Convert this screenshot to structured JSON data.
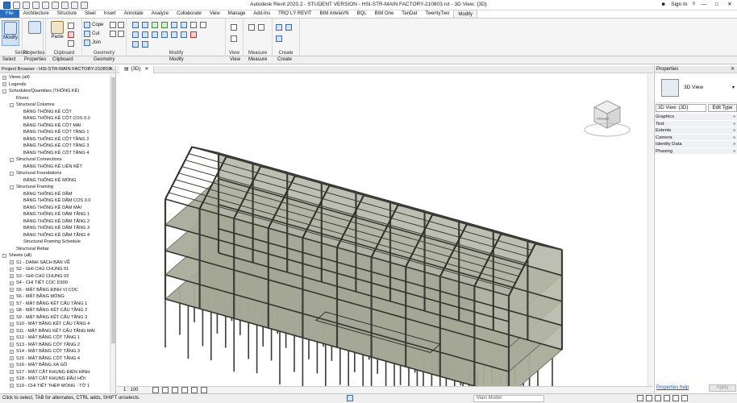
{
  "app": {
    "title": "Autodesk Revit 2020.2 - STUDENT VERSION - HSI-STR-MAIN FACTORY-210803.rvt - 3D View: {3D}",
    "sign_in": "Sign In",
    "help": "?"
  },
  "ribbon_tabs": [
    {
      "label": "File",
      "active": false
    },
    {
      "label": "Architecture",
      "active": false
    },
    {
      "label": "Structure",
      "active": false
    },
    {
      "label": "Steel",
      "active": false
    },
    {
      "label": "Insert",
      "active": false
    },
    {
      "label": "Annotate",
      "active": false
    },
    {
      "label": "Analyze",
      "active": false
    },
    {
      "label": "Collaborate",
      "active": false
    },
    {
      "label": "View",
      "active": false
    },
    {
      "label": "Manage",
      "active": false
    },
    {
      "label": "Add-Ins",
      "active": false
    },
    {
      "label": "TRỢ LÝ REVIT",
      "active": false
    },
    {
      "label": "BIM ArtelaVN",
      "active": false
    },
    {
      "label": "BQL",
      "active": false
    },
    {
      "label": "BIM One",
      "active": false
    },
    {
      "label": "TanDat",
      "active": false
    },
    {
      "label": "TwentyTwo",
      "active": false
    },
    {
      "label": "Modify",
      "active": true
    }
  ],
  "ribbon": {
    "modify_label": "Modify",
    "paste_label": "Paste",
    "cope_label": "Cope",
    "cut_label": "Cut",
    "join_label": "Join",
    "groups": [
      "Select",
      "Properties",
      "Clipboard",
      "Geometry",
      "Modify",
      "View",
      "Measure",
      "Create"
    ]
  },
  "project_browser": {
    "title": "Project Browser - HSI-STR-MAIN FACTORY-210803...",
    "items": [
      {
        "label": "Views (all)",
        "level": 0,
        "exp": "+"
      },
      {
        "label": "Legends",
        "level": 0,
        "exp": "+"
      },
      {
        "label": "Schedules/Quantities (THỐNG KÊ)",
        "level": 0,
        "exp": "-"
      },
      {
        "label": "Floors",
        "level": 1,
        "exp": ""
      },
      {
        "label": "Structural Columns",
        "level": 1,
        "exp": "-"
      },
      {
        "label": "BẢNG THỐNG KÊ CỘT",
        "level": 2,
        "exp": ""
      },
      {
        "label": "BẢNG THỐNG KÊ CỘT COS 0.0",
        "level": 2,
        "exp": ""
      },
      {
        "label": "BẢNG THỐNG KÊ CỘT MÁI",
        "level": 2,
        "exp": ""
      },
      {
        "label": "BẢNG THỐNG KÊ CỘT TẦNG 1",
        "level": 2,
        "exp": ""
      },
      {
        "label": "BẢNG THỐNG KÊ CỘT TẦNG 2",
        "level": 2,
        "exp": ""
      },
      {
        "label": "BẢNG THỐNG KÊ CỘT TẦNG 3",
        "level": 2,
        "exp": ""
      },
      {
        "label": "BẢNG THỐNG KÊ CỘT TẦNG 4",
        "level": 2,
        "exp": ""
      },
      {
        "label": "Structural Connections",
        "level": 1,
        "exp": "-"
      },
      {
        "label": "BẢNG THỐNG KÊ LIÊN KẾT",
        "level": 2,
        "exp": ""
      },
      {
        "label": "Structural Foundations",
        "level": 1,
        "exp": "-"
      },
      {
        "label": "BẢNG THỐNG KÊ MÓNG",
        "level": 2,
        "exp": ""
      },
      {
        "label": "Structural Framing",
        "level": 1,
        "exp": "-"
      },
      {
        "label": "BẢNG THỐNG KÊ DẦM",
        "level": 2,
        "exp": ""
      },
      {
        "label": "BẢNG THỐNG KÊ DẦM COS 0.0",
        "level": 2,
        "exp": ""
      },
      {
        "label": "BẢNG THỐNG KÊ DẦM MÁI",
        "level": 2,
        "exp": ""
      },
      {
        "label": "BẢNG THỐNG KÊ DẦM TẦNG 1",
        "level": 2,
        "exp": ""
      },
      {
        "label": "BẢNG THỐNG KÊ DẦM TẦNG 2",
        "level": 2,
        "exp": ""
      },
      {
        "label": "BẢNG THỐNG KÊ DẦM TẦNG 3",
        "level": 2,
        "exp": ""
      },
      {
        "label": "BẢNG THỐNG KÊ DẦM TẦNG 4",
        "level": 2,
        "exp": ""
      },
      {
        "label": "Structural Framing Schedule",
        "level": 2,
        "exp": ""
      },
      {
        "label": "Structural Rebar",
        "level": 1,
        "exp": ""
      },
      {
        "label": "Sheets (all)",
        "level": 0,
        "exp": "-"
      },
      {
        "label": "S1 - DANH SÁCH BẢN VẼ",
        "level": 1,
        "exp": "+"
      },
      {
        "label": "S2 - GHI CHÚ CHUNG 01",
        "level": 1,
        "exp": "+"
      },
      {
        "label": "S3 - GHI CHÚ CHUNG 02",
        "level": 1,
        "exp": "+"
      },
      {
        "label": "S4 - CHI TIẾT CỌC D300",
        "level": 1,
        "exp": "+"
      },
      {
        "label": "S5 - MẶT BẰNG ĐỊNH VỊ CỌC",
        "level": 1,
        "exp": "+"
      },
      {
        "label": "S6 - MẶT BẰNG MÓNG",
        "level": 1,
        "exp": "+"
      },
      {
        "label": "S7 - MẶT BẰNG KẾT CẤU TẦNG 1",
        "level": 1,
        "exp": "+"
      },
      {
        "label": "S8 - MẶT BẰNG KẾT CẤU TẦNG 2",
        "level": 1,
        "exp": "+"
      },
      {
        "label": "S9 - MẶT BẰNG KẾT CẤU TẦNG 3",
        "level": 1,
        "exp": "+"
      },
      {
        "label": "S10 - MẶT BẰNG KẾT CẤU TẦNG 4",
        "level": 1,
        "exp": "+"
      },
      {
        "label": "S11 - MẶT BẰNG KẾT CẤU TẦNG MÁI",
        "level": 1,
        "exp": "+"
      },
      {
        "label": "S12 - MẶT BẰNG CỘT TẦNG 1",
        "level": 1,
        "exp": "+"
      },
      {
        "label": "S13 - MẶT BẰNG CỘT TẦNG 2",
        "level": 1,
        "exp": "+"
      },
      {
        "label": "S14 - MẶT BẰNG CỘT TẦNG 3",
        "level": 1,
        "exp": "+"
      },
      {
        "label": "S15 - MẶT BẰNG CỘT TẦNG 4",
        "level": 1,
        "exp": "+"
      },
      {
        "label": "S16 - MẶT BẰNG XÀ GỒ",
        "level": 1,
        "exp": "+"
      },
      {
        "label": "S17 - MẶT CẮT KHUNG ĐIỂN HÌNH",
        "level": 1,
        "exp": "+"
      },
      {
        "label": "S18 - MẶT CẮT KHUNG ĐẦU HỒI",
        "level": 1,
        "exp": "+"
      },
      {
        "label": "S19 - CHI TIẾT THÉP MÓNG - TỜ 1",
        "level": 1,
        "exp": "+"
      }
    ]
  },
  "viewport": {
    "tab_label": "{3D}",
    "scale": "1 : 100",
    "viewcube_label": "FRONT"
  },
  "properties": {
    "title": "Properties",
    "type_name": "3D View",
    "selector": "3D View: {3D}",
    "edit_type": "Edit Type",
    "categories": [
      "Graphics",
      "Text",
      "Extents",
      "Camera",
      "Identity Data",
      "Phasing"
    ],
    "help_link": "Properties help",
    "apply": "Apply"
  },
  "status": {
    "message": "Click to select, TAB for alternates, CTRL adds, SHIFT unselects.",
    "model": "Main Model"
  }
}
